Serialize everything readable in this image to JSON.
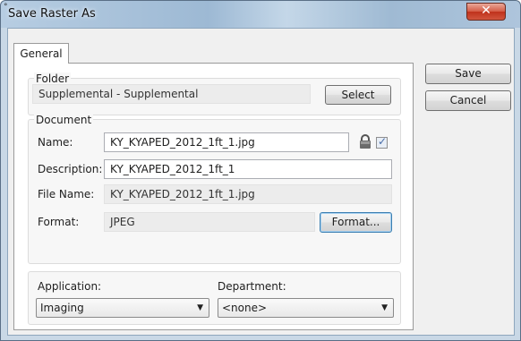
{
  "window": {
    "title": "Save Raster As",
    "close_glyph": "✕"
  },
  "tabs": [
    {
      "label": "General",
      "selected": true
    }
  ],
  "folder": {
    "group_label": "Folder",
    "value": "Supplemental - Supplemental",
    "select_label": "Select"
  },
  "document": {
    "group_label": "Document",
    "name_label": "Name:",
    "name_value": "KY_KYAPED_2012_1ft_1.jpg",
    "name_checked": true,
    "description_label": "Description:",
    "description_value": "KY_KYAPED_2012_1ft_1",
    "filename_label": "File Name:",
    "filename_value": "KY_KYAPED_2012_1ft_1.jpg",
    "format_label": "Format:",
    "format_value": "JPEG",
    "format_button_label": "Format..."
  },
  "bottom": {
    "application_label": "Application:",
    "application_value": "Imaging",
    "department_label": "Department:",
    "department_value": "<none>"
  },
  "actions": {
    "save_label": "Save",
    "cancel_label": "Cancel"
  },
  "icons": {
    "lock": "lock-icon",
    "dropdown": "chevron-down-icon"
  },
  "colors": {
    "titlebar": "#9db9d4",
    "close_button": "#c0321c",
    "focus_border": "#3c7fb1"
  }
}
